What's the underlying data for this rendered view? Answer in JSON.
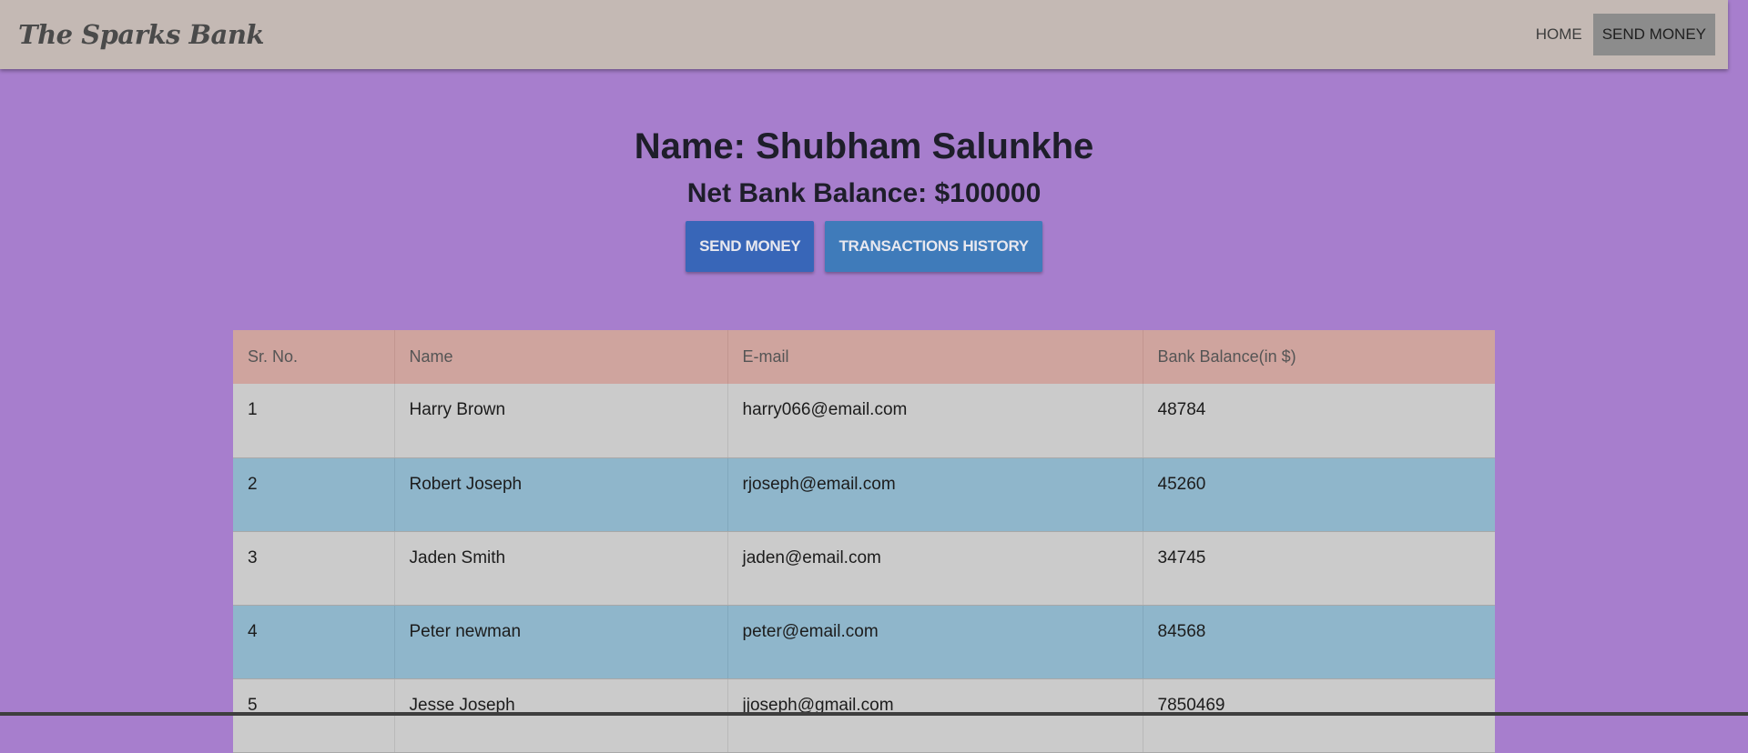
{
  "navbar": {
    "brand": "The Sparks Bank",
    "links": [
      {
        "label": "HOME",
        "active": false
      },
      {
        "label": "SEND MONEY",
        "active": true
      }
    ]
  },
  "profile": {
    "name": "Name: Shubham Salunkhe",
    "balance": "Net Bank Balance: $100000"
  },
  "actions": {
    "send_money": "SEND MONEY",
    "history": "TRANSACTIONS HISTORY"
  },
  "table": {
    "headers": [
      "Sr. No.",
      "Name",
      "E-mail",
      "Bank Balance(in $)"
    ],
    "rows": [
      [
        "1",
        "Harry Brown",
        "harry066@email.com",
        "48784"
      ],
      [
        "2",
        "Robert Joseph",
        "rjoseph@email.com",
        "45260"
      ],
      [
        "3",
        "Jaden Smith",
        "jaden@email.com",
        "34745"
      ],
      [
        "4",
        "Peter newman",
        "peter@email.com",
        "84568"
      ],
      [
        "5",
        "Jesse Joseph",
        "jjoseph@gmail.com",
        "7850469"
      ]
    ]
  },
  "colors": {
    "background": "#a77ecd",
    "navbar": "#c4b9b4",
    "table_header": "#cfa49e",
    "row_light": "#cbcbcb",
    "row_blue": "#8fb6cb",
    "button_send": "#3866b8",
    "button_history": "#3f7bba"
  }
}
